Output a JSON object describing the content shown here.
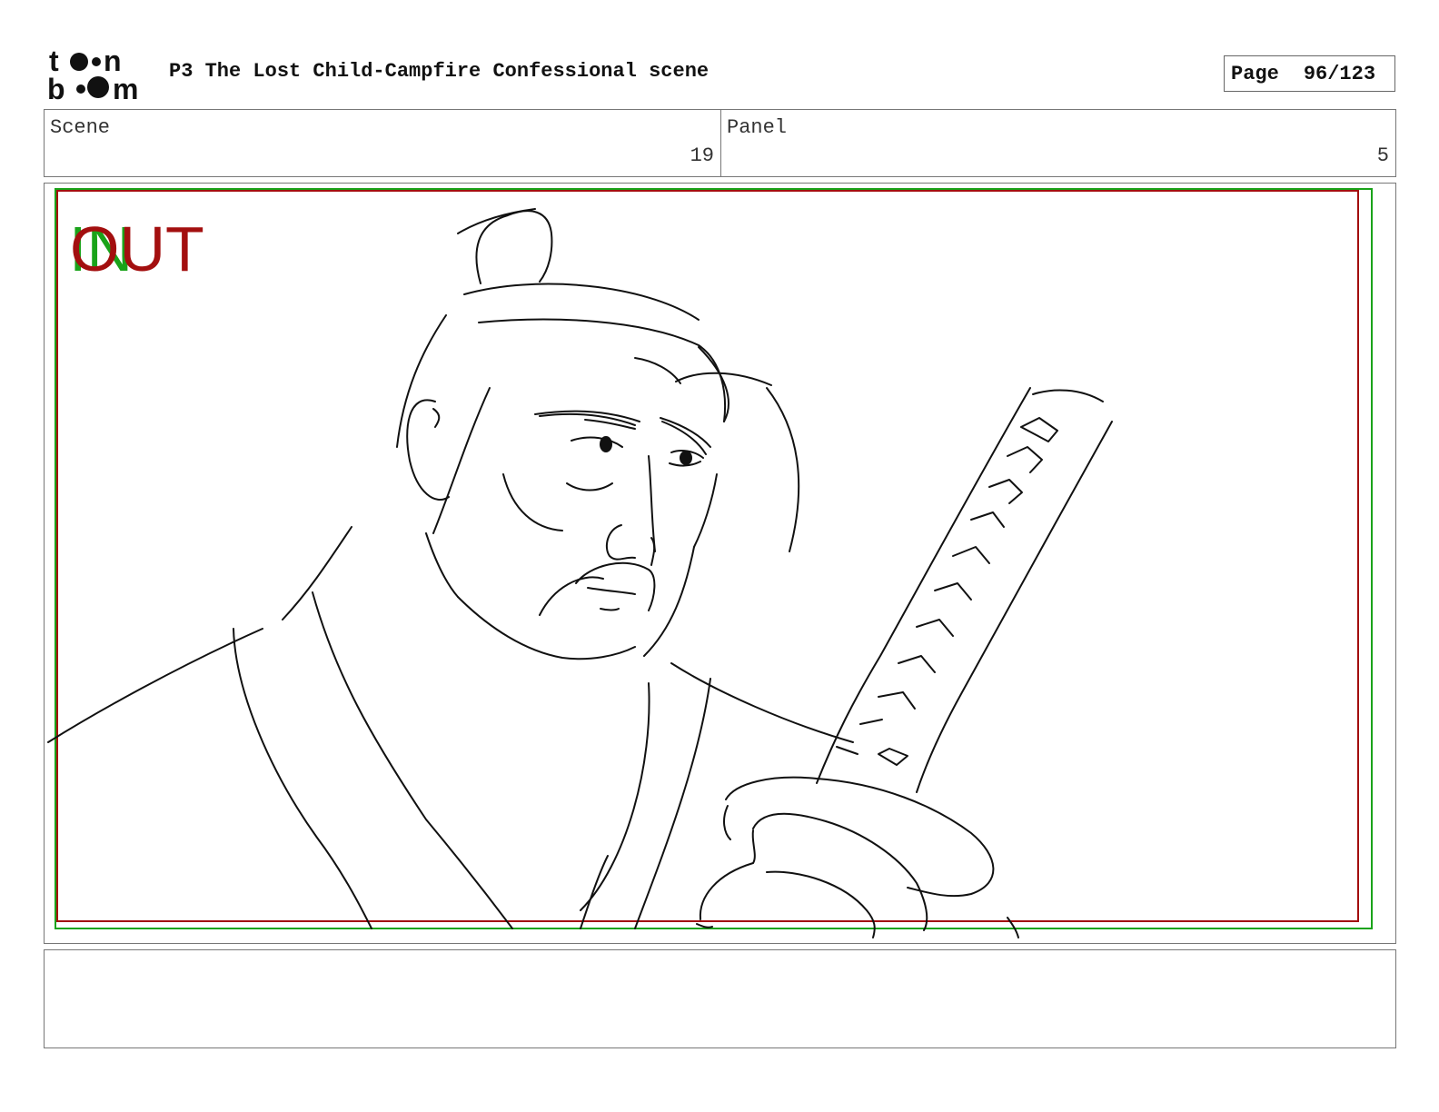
{
  "header": {
    "logo_text": "toon boom",
    "title": "P3 The Lost Child-Campfire Confessional scene",
    "page_label": "Page",
    "page_number": "96/123"
  },
  "info": {
    "scene_label": "Scene",
    "scene_value": "19",
    "panel_label": "Panel",
    "panel_value": "5"
  },
  "frame": {
    "in_marker": "IN",
    "out_marker": "OUT",
    "colors": {
      "in": "#1aa31a",
      "out": "#a30f0f"
    }
  },
  "notes": {
    "text": ""
  }
}
